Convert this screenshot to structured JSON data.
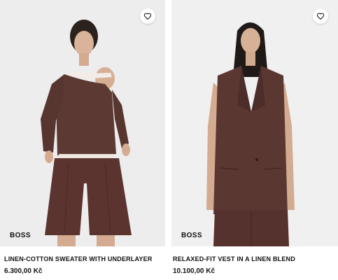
{
  "products": [
    {
      "brand": "BOSS",
      "name": "LINEN-COTTON SWEATER WITH UNDERLAYER",
      "price": "6.300,00 Kč",
      "favorite_icon": "heart-outline-icon"
    },
    {
      "brand": "BOSS",
      "name": "RELAXED-FIT VEST IN A LINEN BLEND",
      "price": "10.100,00 Kč",
      "favorite_icon": "heart-outline-icon"
    }
  ],
  "colors": {
    "background": "#ffffff",
    "photo_bg": "#ededed",
    "garment_brown": "#5a3630",
    "text": "#111111"
  }
}
